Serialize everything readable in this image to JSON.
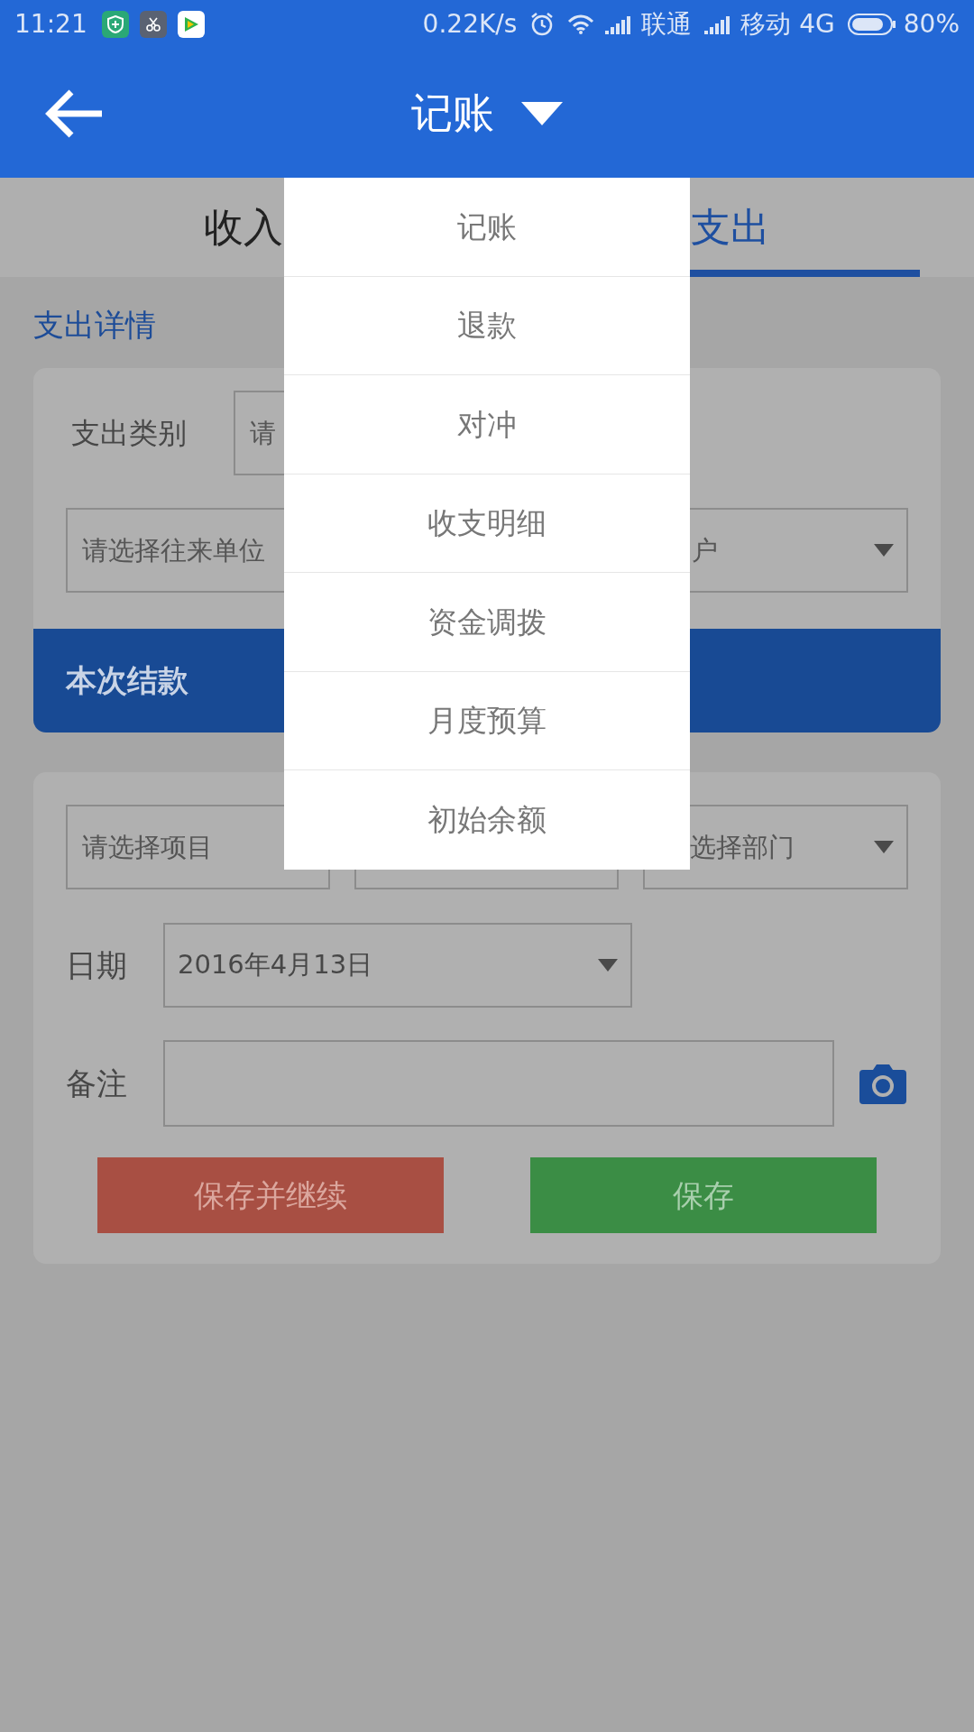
{
  "status_bar": {
    "time": "11:21",
    "speed": "0.22K/s",
    "carrier_1": "联通",
    "carrier_2": "移动 4G",
    "battery": "80%"
  },
  "app_bar": {
    "title": "记账"
  },
  "tabs": [
    {
      "label": "收入",
      "selected": false
    },
    {
      "label": "支出",
      "selected": true
    }
  ],
  "section_title": "支出详情",
  "category": {
    "label": "支出类别",
    "placeholder": "请"
  },
  "party_fields": [
    {
      "placeholder": "请选择往来单位"
    },
    {
      "placeholder": "户",
      "dropdown": true
    }
  ],
  "settlement_header": "本次结款",
  "detail_fields": [
    {
      "kind": "select",
      "placeholder": "请选择项目"
    },
    {
      "kind": "select"
    },
    {
      "kind": "select",
      "placeholder": "选择部门",
      "dropdown": true
    }
  ],
  "date": {
    "label": "日期",
    "value": "2016年4月13日"
  },
  "note": {
    "label": "备注"
  },
  "buttons": [
    {
      "label": "保存并继续",
      "kind": "continue"
    },
    {
      "label": "保存",
      "kind": "save"
    }
  ],
  "menu": [
    {
      "label": "记账"
    },
    {
      "label": "退款"
    },
    {
      "label": "对冲"
    },
    {
      "label": "收支明细"
    },
    {
      "label": "资金调拨"
    },
    {
      "label": "月度预算"
    },
    {
      "label": "初始余额"
    }
  ]
}
